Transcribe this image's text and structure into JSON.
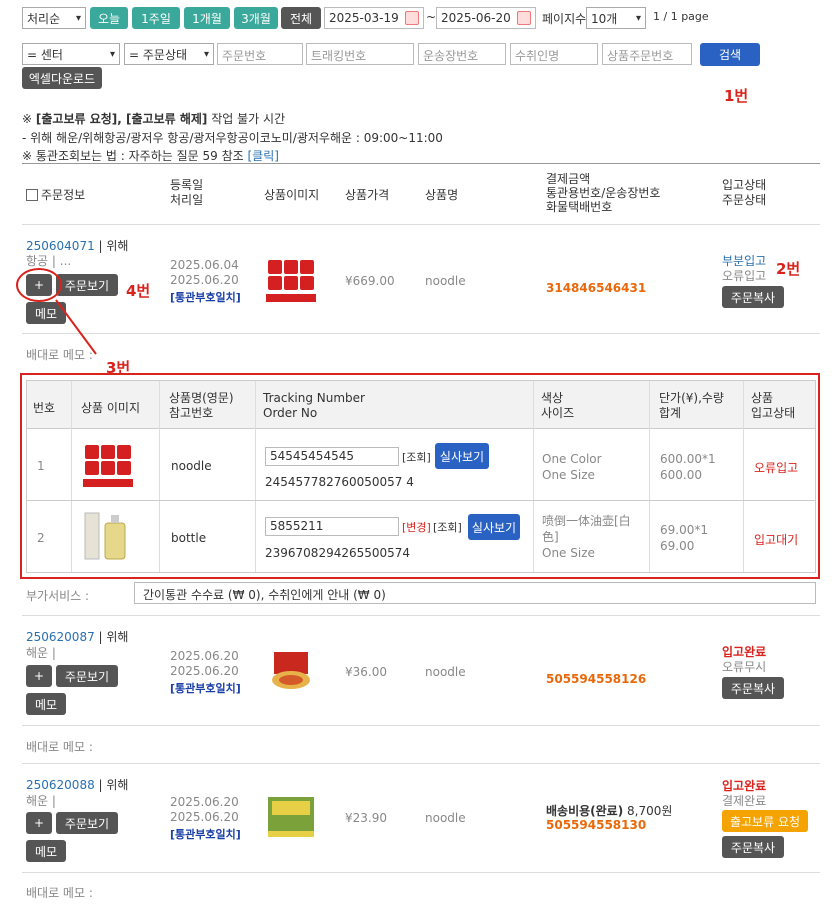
{
  "filters": {
    "sort": "처리순",
    "today": "오늘",
    "week1": "1주일",
    "month1": "1개월",
    "month3": "3개월",
    "all": "전체",
    "date_from": "2025-03-19",
    "tilde": "~",
    "date_to": "2025-06-20",
    "page_size_label": "페이지수",
    "page_size": "10개",
    "page_info": "1 / 1 page",
    "center": "= 센터",
    "order_status": "= 주문상태",
    "ph_order_no": "주문번호",
    "ph_tracking": "트래킹번호",
    "ph_invoice": "운송장번호",
    "ph_receiver": "수취인명",
    "ph_product_order": "상품주문번호",
    "search": "검색",
    "excel": "엑셀다운로드"
  },
  "annotations": {
    "a1": "1번",
    "a2": "2번",
    "a3": "3번",
    "a4": "4번"
  },
  "notice": {
    "line1_prefix": "※",
    "line1_bold": "[출고보류 요청], [출고보류 해제]",
    "line1_rest": "작업 불가 시간",
    "line2": "- 위해 해운/위해항공/광저우 항공/광저우항공이코노미/광저우해운 : 09:00~11:00",
    "line3": "※ 통관조회보는 법 : 자주하는 질문 59 참조",
    "line3_link": "[클릭]"
  },
  "headers": {
    "order_info": "주문정보",
    "reg_date": "등록일",
    "proc_date": "처리일",
    "image": "상품이미지",
    "price": "상품가격",
    "name": "상품명",
    "pay1": "결제금액",
    "pay2": "통관용번호/운송장번호",
    "pay3": "화물택배번호",
    "status1": "입고상태",
    "status2": "주문상태"
  },
  "orders": [
    {
      "no": "250604071",
      "center": "위해",
      "ship_line": "항공 | ...",
      "reg": "2025.06.04",
      "proc": "2025.06.20",
      "customs": "[통관부호일치]",
      "price": "¥669.00",
      "name": "noodle",
      "pay_label": "",
      "pay_amount": "",
      "tracking": "314846546431",
      "status1": "부분입고",
      "status2": "오류입고",
      "copy": "주문복사",
      "memo_label": "배대로 메모 :"
    },
    {
      "no": "250620087",
      "center": "위해",
      "ship_line": "해운 |",
      "reg": "2025.06.20",
      "proc": "2025.06.20",
      "customs": "[통관부호일치]",
      "price": "¥36.00",
      "name": "noodle",
      "pay_label": "",
      "pay_amount": "",
      "tracking": "505594558126",
      "status1": "입고완료",
      "status2": "오류무시",
      "copy": "주문복사",
      "memo_label": "배대로 메모 :"
    },
    {
      "no": "250620088",
      "center": "위해",
      "ship_line": "해운 |",
      "reg": "2025.06.20",
      "proc": "2025.06.20",
      "customs": "[통관부호일치]",
      "price": "¥23.90",
      "name": "noodle",
      "pay_label": "배송비용(완료)",
      "pay_amount": "8,700원",
      "tracking": "505594558130",
      "status1": "입고완료",
      "status2": "결제완료",
      "hold": "출고보류 요청",
      "copy": "주문복사",
      "memo_label": "배대로 메모 :"
    }
  ],
  "buttons": {
    "plus": "+",
    "view": "주문보기",
    "memo": "메모"
  },
  "sub": {
    "h_no": "번호",
    "h_img": "상품 이미지",
    "h_name1": "상품명(영문)",
    "h_name2": "참고번호",
    "h_track1": "Tracking Number",
    "h_track2": "Order No",
    "h_color1": "색상",
    "h_color2": "사이즈",
    "h_unit1": "단가(¥),수량",
    "h_unit2": "합계",
    "h_st1": "상품",
    "h_st2": "입고상태",
    "rows": [
      {
        "no": "1",
        "name": "noodle",
        "tracking": "54545454545",
        "order_no": "245457782760050057 4",
        "change": "",
        "lookup": "[조회]",
        "photo": "실사보기",
        "color": "One Color",
        "size": "One Size",
        "unit": "600.00*1",
        "total": "600.00",
        "status": "오류입고"
      },
      {
        "no": "2",
        "name": "bottle",
        "tracking": "5855211",
        "order_no": "2396708294265500574",
        "change": "[변경]",
        "lookup": "[조회]",
        "photo": "실사보기",
        "color": "喷倒一体油壶[白色]",
        "size": "One Size",
        "unit": "69.00*1",
        "total": "69.00",
        "status": "입고대기"
      }
    ]
  },
  "extra": {
    "label": "부가서비스 :",
    "value": "간이통관 수수료 (₩ 0), 수취인에게 안내 (₩ 0)"
  }
}
